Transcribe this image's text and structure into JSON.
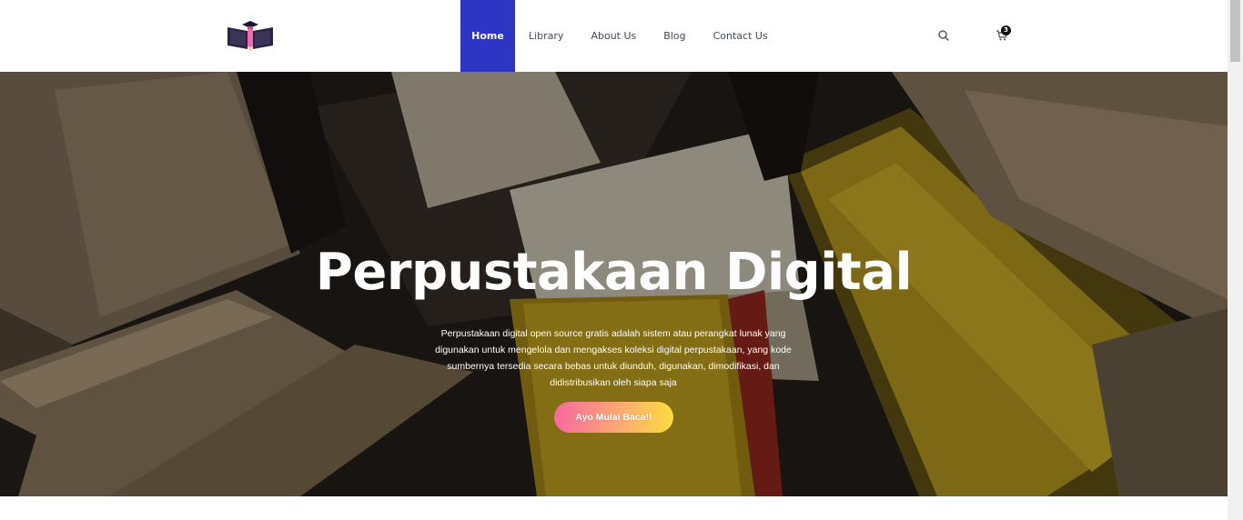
{
  "header": {
    "logo_icon": "open-book-pencil-logo",
    "nav": [
      {
        "label": "Home",
        "active": true
      },
      {
        "label": "Library",
        "active": false
      },
      {
        "label": "About Us",
        "active": false
      },
      {
        "label": "Blog",
        "active": false
      },
      {
        "label": "Contact Us",
        "active": false
      }
    ],
    "search_icon": "search-icon",
    "cart_icon": "cart-icon",
    "cart_count": "3"
  },
  "hero": {
    "title": "Perpustakaan Digital",
    "description": "Perpustakaan digital open source gratis adalah sistem atau perangkat lunak yang digunakan untuk mengelola dan mengakses koleksi digital perpustakaan, yang kode sumbernya tersedia secara bebas untuk diunduh, digunakan, dimodifikasi, dan didistribusikan oleh siapa saja",
    "cta_label": "Ayo Mulai Baca!!",
    "background": "stack-of-books-photo"
  },
  "colors": {
    "accent": "#2e35c4",
    "cta_gradient_start": "#f6689f",
    "cta_gradient_end": "#fbdc3c"
  }
}
